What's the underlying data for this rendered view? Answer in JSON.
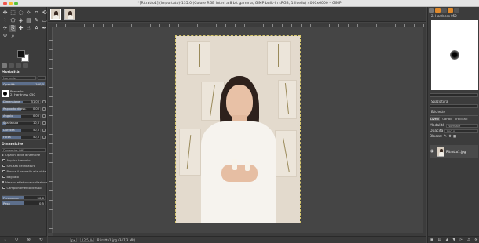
{
  "window": {
    "title": "*[Ritratto1] (importato)-135.0 (Colore RGB interi a 8 bit gamma, GIMP built-in sRGB, 1 livello) 4000x6000 – GIMP"
  },
  "toolbox": {
    "tools": [
      {
        "icon": "move-icon",
        "glyph": "✥"
      },
      {
        "icon": "rect-select-icon",
        "glyph": "⬚"
      },
      {
        "icon": "lasso-icon",
        "glyph": "◌"
      },
      {
        "icon": "fuzzy-select-icon",
        "glyph": "✧"
      },
      {
        "icon": "crop-icon",
        "glyph": "⌗"
      },
      {
        "icon": "rotate-icon",
        "glyph": "⟲"
      },
      {
        "icon": "warp-icon",
        "glyph": "⌇"
      },
      {
        "icon": "cage-icon",
        "glyph": "⬠"
      },
      {
        "icon": "bucket-fill-icon",
        "glyph": "◈"
      },
      {
        "icon": "gradient-icon",
        "glyph": "▤"
      },
      {
        "icon": "paintbrush-icon",
        "glyph": "✎"
      },
      {
        "icon": "eraser-icon",
        "glyph": "▭"
      },
      {
        "icon": "airbrush-icon",
        "glyph": "✈"
      },
      {
        "icon": "clone-icon",
        "glyph": "⎘"
      },
      {
        "icon": "heal-icon",
        "glyph": "✚"
      },
      {
        "icon": "smudge-icon",
        "glyph": "☝"
      },
      {
        "icon": "text-icon",
        "glyph": "A"
      },
      {
        "icon": "paths-icon",
        "glyph": "✒"
      },
      {
        "icon": "color-picker-icon",
        "glyph": "⚲"
      },
      {
        "icon": "zoom-icon",
        "glyph": "⌕"
      }
    ],
    "active_tool_index": 13
  },
  "tool_options": {
    "section_title": "Modalità",
    "mode_value": "Normale",
    "opacity_label": "Opacità",
    "opacity_value": "100,0",
    "opacity_fraction": 1.0,
    "brush_section": "Pennello",
    "brush_name": "2. Hardness 050",
    "params": [
      {
        "label": "Dimensione",
        "value": "51,00",
        "fraction": 0.55
      },
      {
        "label": "Rapporto di asp.",
        "value": "0,00",
        "fraction": 0.5
      },
      {
        "label": "Angolo",
        "value": "0,00",
        "fraction": 0.5
      },
      {
        "label": "Spaziatura",
        "value": "10,0",
        "fraction": 0.1
      },
      {
        "label": "Durezza",
        "value": "50,0",
        "fraction": 0.5
      },
      {
        "label": "Forza",
        "value": "50,0",
        "fraction": 0.5
      }
    ],
    "dynamics_title": "Dinamiche",
    "dynamics_value": "Dynamics Off",
    "dynamics_options_title": "Opzioni delle dinamiche",
    "checks": [
      "Applica tremolio",
      "Smussa delineatura",
      "Blocca il pennello alla vista",
      "Bagnato",
      "Nessun effetto cancellazione",
      "Campionamento diffuso"
    ],
    "freq_label": "Frequenza",
    "freq_value": "50,0",
    "freq_fraction": 0.5,
    "scale_label": "Peso",
    "scale_value": "0,5",
    "scale_fraction": 0.5
  },
  "status": {
    "unit": "px",
    "zoom": "12,5 %",
    "file_info": "Ritratto1.jpg (347,3 MB)"
  },
  "brushes_dock": {
    "title": "2. Hardness 050",
    "spacing_label": "Spaziatura",
    "filter_label": "Etichette"
  },
  "layers_dock": {
    "tabs": [
      "Livelli",
      "Canali",
      "Tracciati"
    ],
    "mode_label": "Modalità",
    "mode_value": "Normale",
    "opacity_label": "Opacità",
    "opacity_value": "100,0",
    "lock_label": "Blocca:",
    "layers": [
      {
        "name": "Ritratto1.jpg"
      }
    ]
  }
}
